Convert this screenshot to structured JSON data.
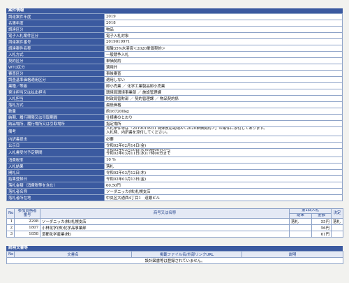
{
  "case": {
    "header": "案件情報",
    "rows": [
      {
        "label": "調達案件年度",
        "value": "2019"
      },
      {
        "label": "名簿年度",
        "value": "2018"
      },
      {
        "label": "調達区分",
        "value": "物品"
      },
      {
        "label": "電子入札案件区分",
        "value": "電子入札対象"
      },
      {
        "label": "調達案件番号",
        "value": "2019019971"
      },
      {
        "label": "調達案件名称",
        "value": "塩酸35%水溶液＜2020単価契約＞"
      },
      {
        "label": "入札方式",
        "value": "一般競争入札"
      },
      {
        "label": "契約区分",
        "value": "単価契約"
      },
      {
        "label": "WTO区分",
        "value": "適用外"
      },
      {
        "label": "審査区分",
        "value": "事後審査"
      },
      {
        "label": "調査基準価格適用区分",
        "value": "適用しない"
      },
      {
        "label": "業種／等級",
        "value": "卸小売業 ／ 化学工業製品卸小売業"
      },
      {
        "label": "発注担当又は払出担当",
        "value": "環境局環境事業部 ／ 施設管理課"
      },
      {
        "label": "入札担当",
        "value": "財政局管財部 ／ 契約管理課 ／ 物品契約係"
      },
      {
        "label": "落札方式",
        "value": "最低価格"
      },
      {
        "label": "数量",
        "value": "約167200kg"
      },
      {
        "label": "納期、履行期限又は引取期間",
        "value": "仕様書のとおり"
      },
      {
        "label": "納品場所、履行場所又は引取場所",
        "value": "指定場所"
      },
      {
        "label": "備考",
        "value": "入札条件等は「2019019931 特殊反応助剤A＜2020単価契約＞」の案件に添付してあります。\n入札時、内訳書を添付してください。"
      },
      {
        "label": "内訳書提出",
        "value": "必要"
      },
      {
        "label": "公示日",
        "value": "令和02年02月14日(金)"
      },
      {
        "label": "入札書受付予定期間",
        "value": "令和02年03月10日(火)09時00分から\n令和02年03月11日(水)17時00分まで"
      },
      {
        "label": "消費税率",
        "value": "10 %"
      },
      {
        "label": "入札結果",
        "value": "落札"
      },
      {
        "label": "開札日",
        "value": "令和02年03月12日(木)"
      },
      {
        "label": "結果登録日",
        "value": "令和02年03月13日(金)"
      },
      {
        "label": "落札金額（消費税等を含む）",
        "value": "60.50円"
      },
      {
        "label": "落札者名称",
        "value": "ソーダニッカ(株)札幌支店"
      },
      {
        "label": "落札者所在地",
        "value": "中央区大通西4丁目1　道銀ビル"
      }
    ]
  },
  "bids": {
    "headers": {
      "no": "No",
      "reg": "参加資格者番号",
      "name": "商号又は名称",
      "round": "第1回入札",
      "result": "結果",
      "amount": "金額",
      "decision": "決定"
    },
    "rows": [
      {
        "no": "1",
        "reg": "2298",
        "name": "ソーダニッカ(株)札幌支店",
        "result": "落札",
        "amount": "55円",
        "decision": "落札"
      },
      {
        "no": "2",
        "reg": "1807",
        "name": "小林化学(株)化学品事業部",
        "result": "",
        "amount": "56円",
        "decision": ""
      },
      {
        "no": "3",
        "reg": "1858",
        "name": "道都化学産業(株)",
        "result": "",
        "amount": "61円",
        "decision": ""
      }
    ]
  },
  "docs": {
    "header": "説明文書等",
    "headers": {
      "no": "No",
      "doc": "文書名",
      "file": "掲載ファイル名/外部リンクURL",
      "desc": "説明"
    },
    "empty": "設計図書等は登録されていません。"
  }
}
